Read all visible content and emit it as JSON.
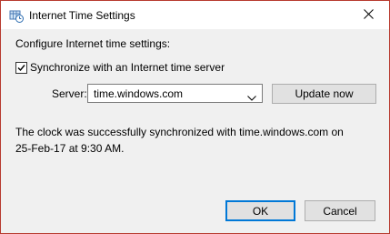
{
  "window": {
    "title": "Internet Time Settings",
    "icon": "clock-globe-icon",
    "close_icon": "close-icon"
  },
  "content": {
    "heading": "Configure Internet time settings:",
    "sync_checkbox": {
      "label": "Synchronize with an Internet time server",
      "checked": true
    },
    "server": {
      "label": "Server:",
      "value": "time.windows.com"
    },
    "update_button": "Update now",
    "status_line1": "The clock was successfully synchronized with time.windows.com on",
    "status_line2": "25-Feb-17 at 9:30 AM."
  },
  "footer": {
    "ok_label": "OK",
    "cancel_label": "Cancel"
  },
  "colors": {
    "window_border": "#b73a2f",
    "dialog_bg": "#f0f0f0",
    "button_bg": "#e1e1e1",
    "accent": "#0078d7"
  }
}
